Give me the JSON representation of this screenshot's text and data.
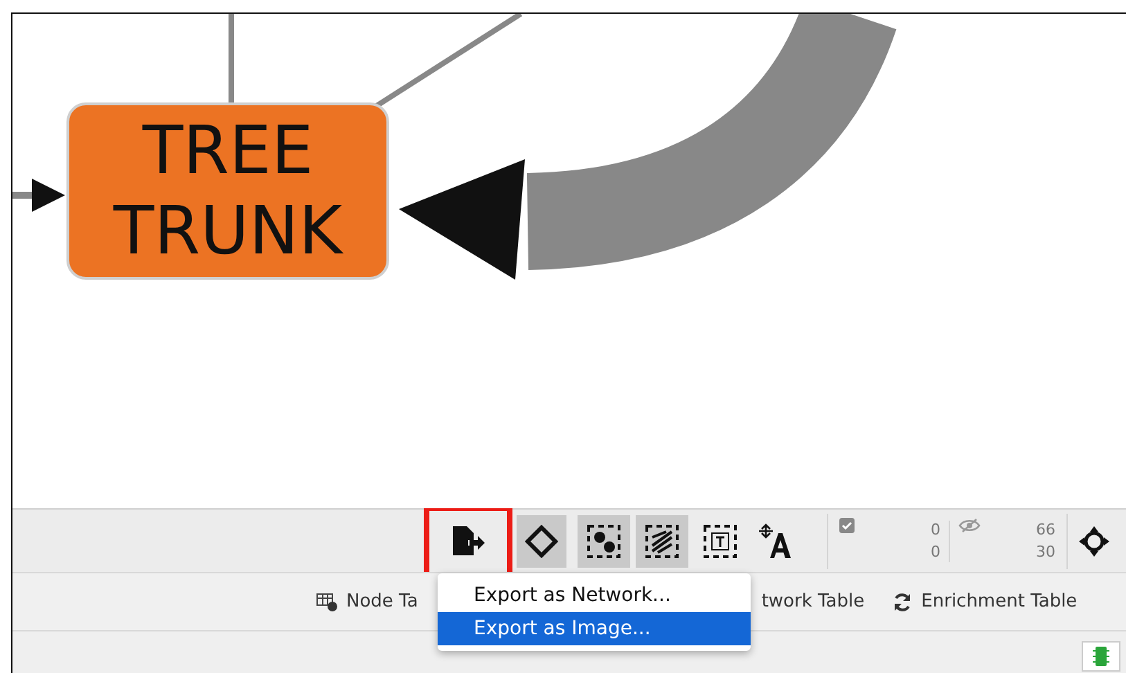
{
  "network": {
    "node": {
      "label": "TREE TRUNK"
    }
  },
  "toolbar": {
    "buttons": [
      {
        "kind": "export",
        "selected": false,
        "annotated": true
      },
      {
        "kind": "diamond",
        "selected": true,
        "annotated": false
      },
      {
        "kind": "select-nodes",
        "selected": true,
        "annotated": false
      },
      {
        "kind": "select-edges",
        "selected": true,
        "annotated": false
      },
      {
        "kind": "annotation",
        "selected": false,
        "annotated": false
      },
      {
        "kind": "font",
        "selected": false,
        "annotated": false
      }
    ],
    "selected_counts": [
      "0",
      "0"
    ],
    "hidden_counts": [
      "66",
      "30"
    ]
  },
  "tabs": [
    {
      "label": "Node Ta",
      "kind": "table"
    },
    {
      "label": "twork Table",
      "kind": "plain"
    },
    {
      "label": "Enrichment Table",
      "kind": "refresh"
    }
  ],
  "export_menu": {
    "items": [
      {
        "label": "Export as Network...",
        "selected": false
      },
      {
        "label": "Export as Image...",
        "selected": true
      }
    ]
  }
}
